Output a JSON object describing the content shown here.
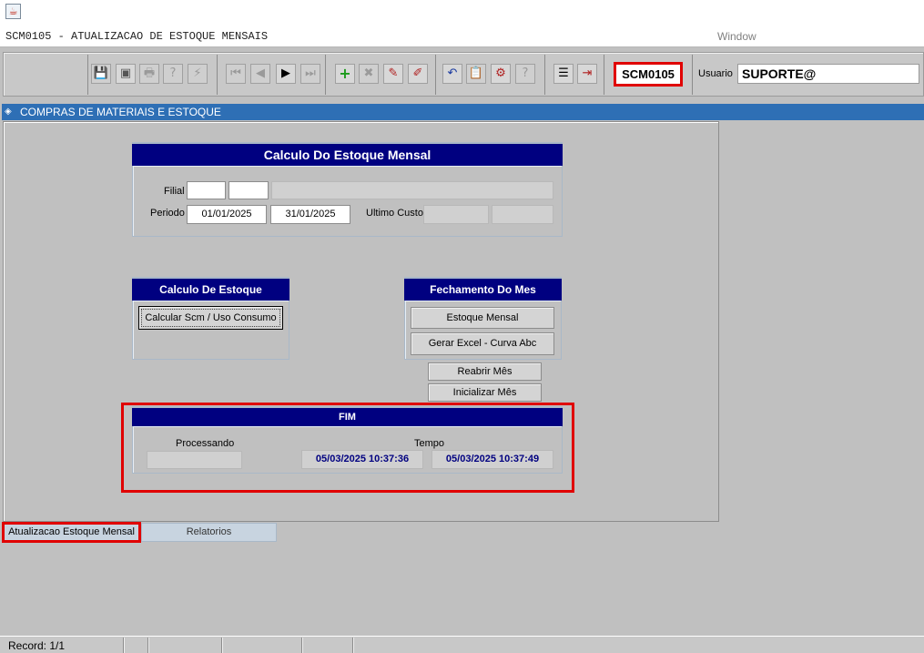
{
  "appbar": {
    "icon": "java-cup-icon"
  },
  "titlebar": {
    "form_title": "SCM0105 - ATUALIZACAO DE ESTOQUE MENSAIS",
    "window_menu": "Window"
  },
  "toolbar": {
    "icons": {
      "save": "💾",
      "window": "▣",
      "print": "🖶",
      "query": "?",
      "execute": "⚡",
      "first": "⏮",
      "prev": "◀",
      "next": "▶",
      "last": "⏭",
      "insert": "+",
      "delete": "✖",
      "edit": "✎",
      "clear": "✐",
      "undo": "↶",
      "copy": "📋",
      "settings": "⚙",
      "help": "?",
      "menu": "☰",
      "exit": "⇥"
    },
    "form_code": "SCM0105",
    "user_label": "Usuario",
    "user_value": "SUPORTE@"
  },
  "module": {
    "title": "COMPRAS DE MATERIAIS E ESTOQUE"
  },
  "calc_panel": {
    "title": "Calculo Do Estoque Mensal",
    "filial_label": "Filial",
    "periodo_label": "Periodo",
    "periodo_start": "01/01/2025",
    "periodo_end": "31/01/2025",
    "ultimo_custo_label": "Ultimo Custo"
  },
  "estoque_panel": {
    "title": "Calculo De Estoque",
    "calc_button": "Calcular Scm / Uso Consumo"
  },
  "fechamento_panel": {
    "title": "Fechamento Do Mes",
    "estoque_button": "Estoque Mensal",
    "excel_button": "Gerar Excel - Curva Abc",
    "reabrir_button": "Reabrir Mês",
    "inicializar_button": "Inicializar Mês"
  },
  "fim_panel": {
    "title": "FIM",
    "processando_label": "Processando",
    "tempo_label": "Tempo",
    "tempo_start": "05/03/2025 10:37:36",
    "tempo_end": "05/03/2025 10:37:49"
  },
  "tabs": {
    "active": "Atualizacao Estoque Mensal",
    "reports": "Relatorios"
  },
  "status": {
    "record": "Record: 1/1"
  },
  "colors": {
    "header_navy": "#000080",
    "module_blue": "#2e6fb5",
    "highlight_red": "#e00000"
  }
}
